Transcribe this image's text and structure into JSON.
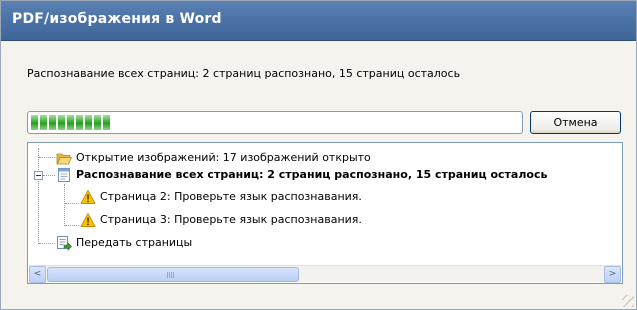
{
  "window": {
    "title": "PDF/изображения в Word"
  },
  "status": {
    "text": "Распознавание всех страниц: 2 страниц распознано, 15 страниц осталось"
  },
  "progress": {
    "segments": 9,
    "fraction": 0.18
  },
  "cancel_button": {
    "label": "Отмена"
  },
  "tree": {
    "items": [
      {
        "label": "Открытие изображений: 17 изображений открыто",
        "icon": "folder-open-icon",
        "bold": false,
        "level": 0
      },
      {
        "label": "Распознавание всех страниц: 2 страниц распознано, 15 страниц осталось",
        "icon": "document-icon",
        "bold": true,
        "level": 0,
        "expanded": true
      },
      {
        "label": "Страница 2: Проверьте язык распознавания.",
        "icon": "warning-icon",
        "bold": false,
        "level": 1
      },
      {
        "label": "Страница 3: Проверьте язык распознавания.",
        "icon": "warning-icon",
        "bold": false,
        "level": 1
      },
      {
        "label": "Передать страницы",
        "icon": "export-word-icon",
        "bold": false,
        "level": 0
      }
    ]
  },
  "scrollbar": {
    "left_arrow": "<",
    "right_arrow": ">"
  },
  "colors": {
    "title_bar": "#4b72a6",
    "progress_green": "#39b12f",
    "warning": "#f5c400"
  }
}
